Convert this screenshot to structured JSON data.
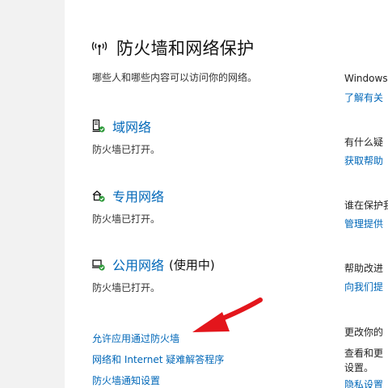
{
  "header": {
    "title": "防火墙和网络保护",
    "subtitle": "哪些人和哪些内容可以访问你的网络。"
  },
  "networks": [
    {
      "name": "域网络",
      "status": "防火墙已打开。",
      "tag": ""
    },
    {
      "name": "专用网络",
      "status": "防火墙已打开。",
      "tag": ""
    },
    {
      "name": "公用网络",
      "status": "防火墙已打开。",
      "tag": "(使用中)"
    }
  ],
  "links": {
    "allow_app": "允许应用通过防火墙",
    "troubleshooter": "网络和 Internet 疑难解答程序",
    "notify_settings": "防火墙通知设置"
  },
  "sidebar": {
    "windows_title": "Windows",
    "windows_link": "了解有关",
    "question_title": "有什么疑",
    "help_link": "获取帮助",
    "protect_title": "谁在保护我",
    "provider_link": "管理提供",
    "improve_title": "帮助改进",
    "feedback_link": "向我们提",
    "change_title": "更改你的",
    "view_text_1": "查看和更",
    "view_text_2": "设置。",
    "privacy_link": "隐私设置"
  },
  "colors": {
    "link": "#0067b8",
    "nav_bg": "#f2f2f2",
    "arrow": "#e3161c",
    "check": "#2e9a3a"
  },
  "icons": {
    "header": "wifi-shield-icon",
    "domain": "domain-network-icon",
    "private": "private-network-icon",
    "public": "public-network-icon",
    "annotation": "red-arrow"
  }
}
